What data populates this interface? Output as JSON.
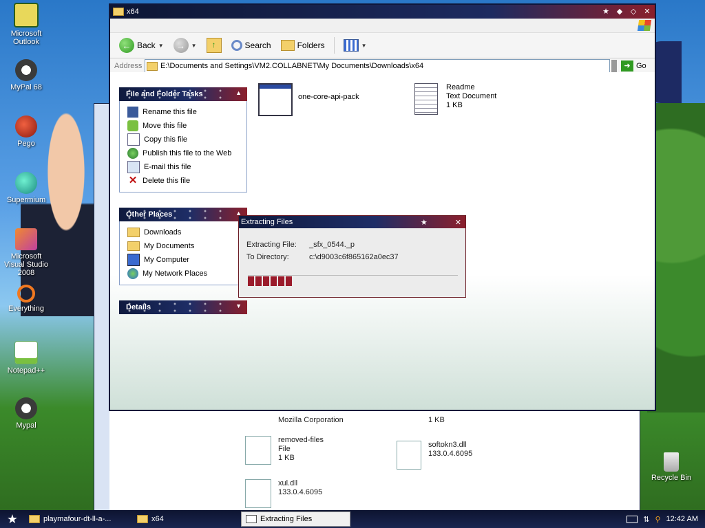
{
  "desktop": {
    "icons": [
      {
        "label": "Microsoft Outlook",
        "icon": "outlook-icon"
      },
      {
        "label": "MyPal 68",
        "icon": "mypal-icon"
      },
      {
        "label": "Pego",
        "icon": "pego-icon"
      },
      {
        "label": "Supermium",
        "icon": "supermium-icon"
      },
      {
        "label": "Microsoft Visual Studio 2008",
        "icon": "visual-studio-icon"
      },
      {
        "label": "Everything",
        "icon": "everything-icon"
      },
      {
        "label": "Notepad++",
        "icon": "notepadpp-icon"
      },
      {
        "label": "Mypal",
        "icon": "mypal-icon"
      },
      {
        "label": "Recycle Bin",
        "icon": "recycle-bin-icon"
      }
    ]
  },
  "back_window": {
    "items": [
      {
        "name": "Mozilla Corporation",
        "detail": ""
      },
      {
        "name": "1 KB",
        "detail": ""
      },
      {
        "name": "removed-files",
        "type": "File",
        "size": "1 KB"
      },
      {
        "name": "softokn3.dll",
        "version": "133.0.4.6095"
      },
      {
        "name": "xul.dll",
        "version": "133.0.4.6095"
      }
    ]
  },
  "explorer": {
    "title": "x64",
    "toolbar": {
      "back": "Back",
      "search": "Search",
      "folders": "Folders"
    },
    "address": {
      "label": "Address",
      "path": "E:\\Documents and Settings\\VM2.COLLABNET\\My Documents\\Downloads\\x64",
      "go": "Go"
    },
    "file_tasks": {
      "header": "File and Folder Tasks",
      "items": [
        "Rename this file",
        "Move this file",
        "Copy this file",
        "Publish this file to the Web",
        "E-mail this file",
        "Delete this file"
      ]
    },
    "other_places": {
      "header": "Other Places",
      "items": [
        "Downloads",
        "My Documents",
        "My Computer",
        "My Network Places"
      ]
    },
    "details": {
      "header": "Details"
    },
    "files": [
      {
        "name": "one-core-api-pack"
      },
      {
        "name": "Readme",
        "type": "Text Document",
        "size": "1 KB"
      }
    ]
  },
  "dialog": {
    "title": "Extracting Files",
    "file_label": "Extracting File:",
    "file_value": "_sfx_0544._p",
    "dir_label": "To Directory:",
    "dir_value": "c:\\d9003c6f865162a0ec37",
    "progress_blocks": 6
  },
  "taskbar": {
    "buttons": [
      {
        "label": "playmafour-dt-ll-a-..."
      },
      {
        "label": "x64"
      },
      {
        "label": "Extracting Files"
      }
    ],
    "clock": "12:42 AM"
  },
  "colors": {
    "accent_red": "#9b1b2b",
    "title_navy": "#0f1a3e"
  }
}
